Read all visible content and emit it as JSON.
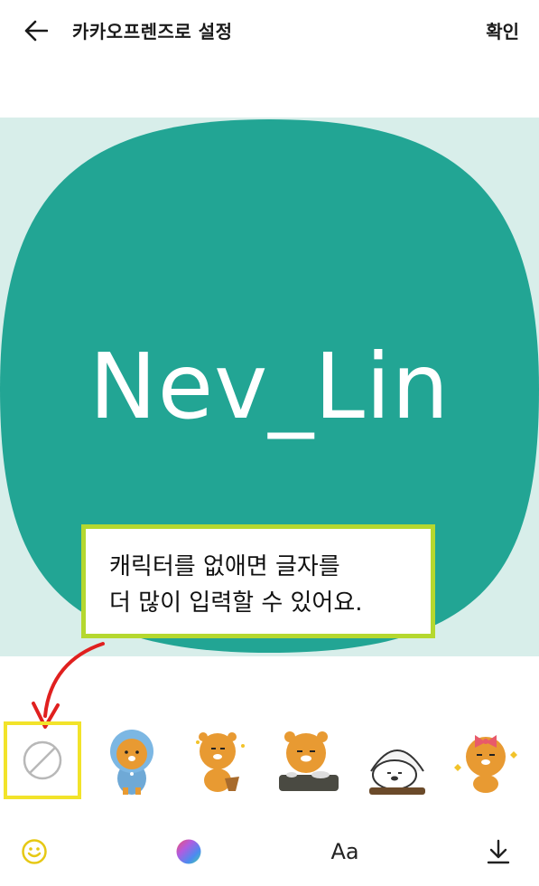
{
  "header": {
    "title": "카카오프렌즈로 설정",
    "confirm_label": "확인"
  },
  "preview": {
    "text": "Nev_Lin",
    "background_color": "#d8eeea",
    "shape_color": "#22a594"
  },
  "tooltip": {
    "line1": "캐릭터를 없애면 글자를",
    "line2": "더 많이 입력할 수 있어요."
  },
  "characters": [
    {
      "name": "none",
      "icon": "no-character-icon",
      "selected": true
    },
    {
      "name": "ryan-hoodie",
      "icon": "ryan-hoodie-icon"
    },
    {
      "name": "ryan-basket",
      "icon": "ryan-basket-icon"
    },
    {
      "name": "ryan-dishes",
      "icon": "ryan-dishes-icon"
    },
    {
      "name": "bear-sleeping",
      "icon": "bear-sleeping-icon"
    },
    {
      "name": "ryan-bow",
      "icon": "ryan-bow-icon"
    }
  ],
  "toolbar": {
    "emoji_icon": "smiley-icon",
    "color_icon": "color-wheel-icon",
    "font_label": "Aa",
    "download_icon": "download-icon"
  },
  "colors": {
    "accent_yellow": "#f2e32a",
    "tooltip_border": "#b5d82f",
    "arrow_red": "#e0201f"
  }
}
